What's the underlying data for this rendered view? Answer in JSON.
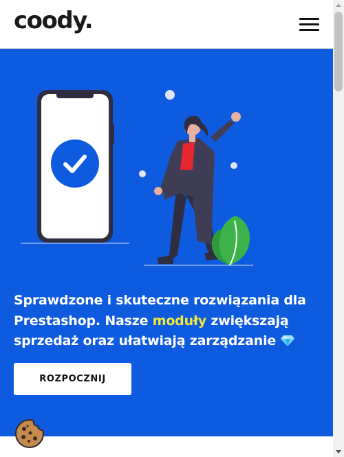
{
  "header": {
    "logo_text": "coody.",
    "menu_icon": "hamburger-menu-icon"
  },
  "hero": {
    "background_color": "#0e5be0",
    "headline_part1": "Sprawdzone i skuteczne rozwiązania dla Prestashop. Nasze ",
    "headline_highlight": "moduły",
    "headline_part2": " zwiększają sprzedaż oraz ułatwiają zarządzanie",
    "highlight_color": "#f2ea3b",
    "headline_icon": "diamond-icon",
    "cta_label": "ROZPOCZNIJ"
  },
  "illustration": {
    "phone_icon": "check-circle-icon",
    "accent_red": "#e5262f",
    "plant_green": "#3bb34a"
  },
  "cookie": {
    "icon": "cookie-icon"
  }
}
